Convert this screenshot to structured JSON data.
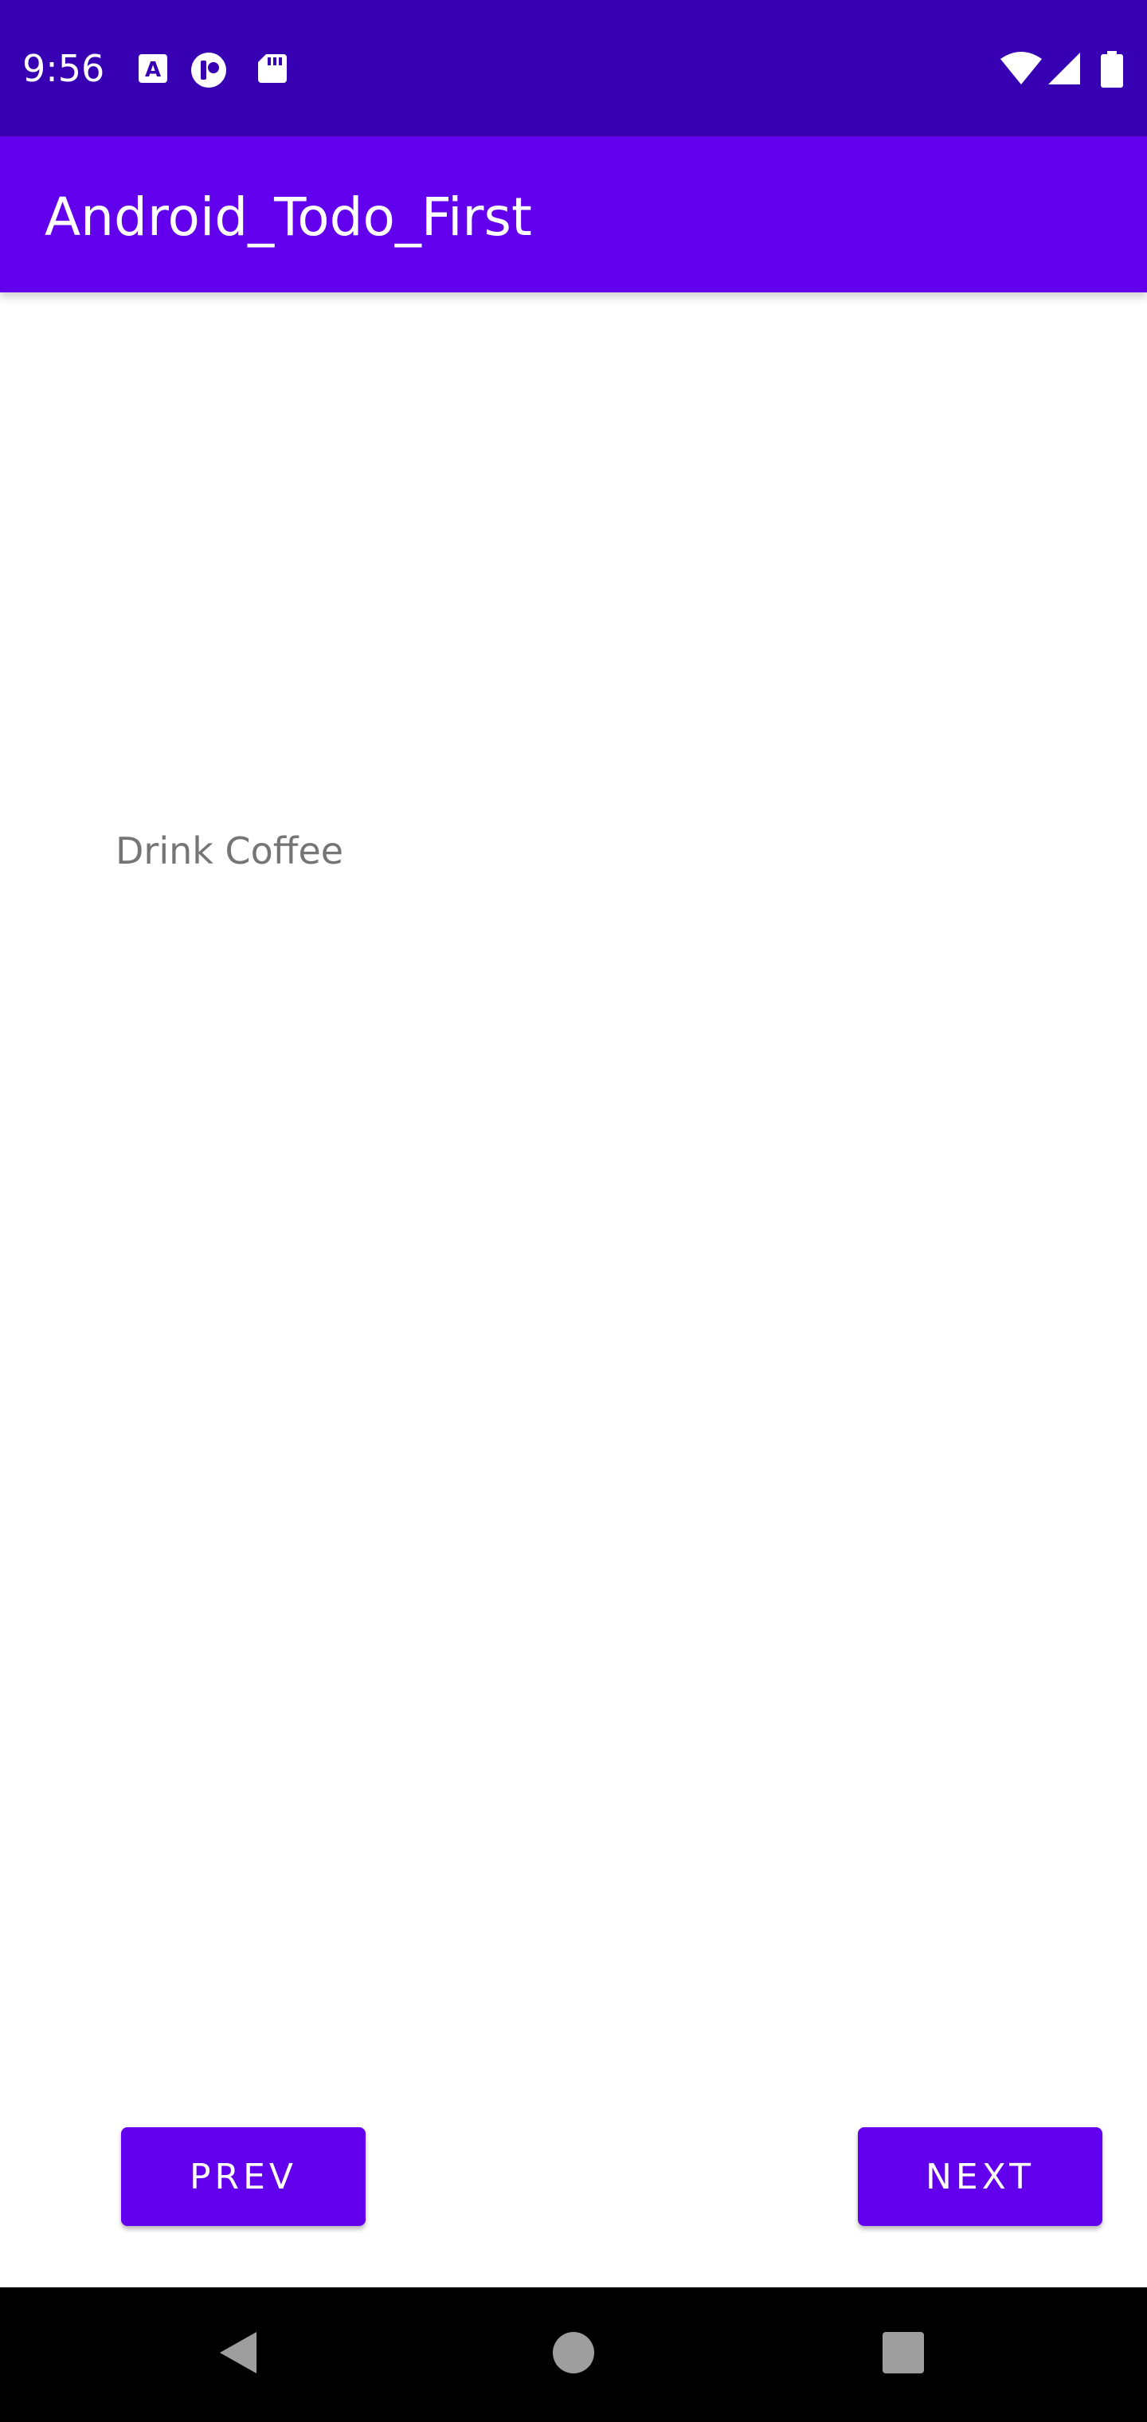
{
  "status_bar": {
    "time": "9:56",
    "icons_left": [
      "a-notification-icon",
      "pause-circle-icon",
      "sd-card-icon"
    ],
    "icons_right": [
      "wifi-icon",
      "signal-icon",
      "battery-icon"
    ],
    "background": "#3700b3"
  },
  "app_bar": {
    "title": "Android_Todo_First",
    "background": "#6200ee"
  },
  "content": {
    "todo_text": "Drink Coffee"
  },
  "buttons": {
    "prev_label": "PREV",
    "next_label": "NEXT",
    "color": "#6200ee"
  },
  "nav_bar": {
    "items": [
      "back-icon",
      "home-icon",
      "recents-icon"
    ]
  }
}
